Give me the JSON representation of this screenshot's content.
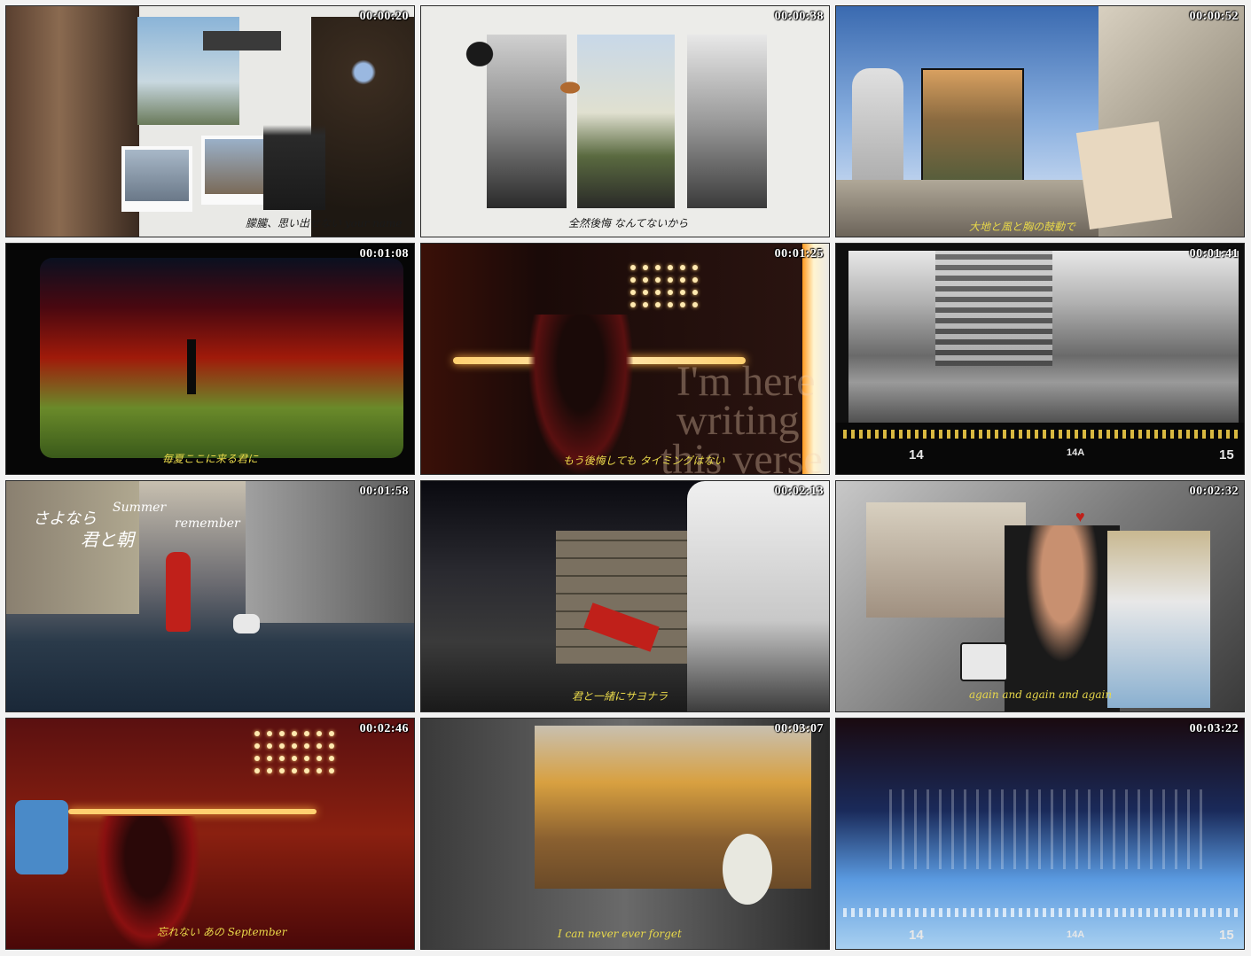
{
  "tiles": [
    {
      "timestamp": "00:00:20",
      "caption": "朦朧、思い出せない your name",
      "caption_color": "#1a1a1a"
    },
    {
      "timestamp": "00:00:38",
      "caption": "全然後悔 なんてないから",
      "caption_color": "#1a1a1a"
    },
    {
      "timestamp": "00:00:52",
      "caption": "大地と風と胸の鼓動で",
      "caption_color": "#e8d84a"
    },
    {
      "timestamp": "00:01:08",
      "caption": "毎夏ここに来る君に",
      "caption_color": "#e8d84a"
    },
    {
      "timestamp": "00:01:25",
      "caption": "もう後悔しても タイミングはない",
      "caption_color": "#e8d84a",
      "overlay_text": [
        "I'm here",
        "writing",
        "this verse"
      ]
    },
    {
      "timestamp": "00:01:41",
      "caption": "",
      "caption_color": "#ffffff",
      "film_numbers": [
        "14",
        "14A",
        "15"
      ]
    },
    {
      "timestamp": "00:01:58",
      "caption": "",
      "caption_color": "#ffffff",
      "overlay_text": [
        "さよなら",
        "Summer",
        "君と朝",
        "remember"
      ]
    },
    {
      "timestamp": "00:02:13",
      "caption": "君と一緒にサヨナラ",
      "caption_color": "#e8d84a"
    },
    {
      "timestamp": "00:02:32",
      "caption": "again and again and again",
      "caption_color": "#e8d84a"
    },
    {
      "timestamp": "00:02:46",
      "caption": "忘れない あの September",
      "caption_color": "#e8d84a"
    },
    {
      "timestamp": "00:03:07",
      "caption": "I can never ever forget",
      "caption_color": "#e8d84a"
    },
    {
      "timestamp": "00:03:22",
      "caption": "",
      "caption_color": "#ffffff",
      "film_numbers": [
        "14",
        "14A",
        "15"
      ]
    }
  ]
}
